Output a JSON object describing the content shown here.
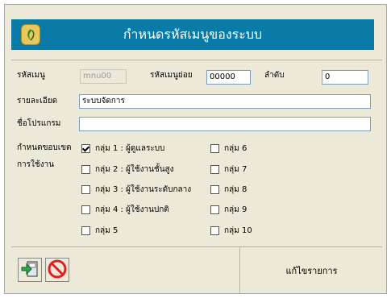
{
  "window": {
    "title": "กำหนดรหัสเมนูของระบบ"
  },
  "form": {
    "menu_code_label": "รหัสเมนู",
    "menu_code_value": "mnu00",
    "submenu_code_label": "รหัสเมนูย่อย",
    "submenu_code_value": "00000",
    "order_label": "ลำดับ",
    "order_value": "0",
    "detail_label": "รายละเอียด",
    "detail_value": "ระบบจัดการ",
    "program_name_label": "ชื่อโปรแกรม",
    "program_name_value": "",
    "scope_label_line1": "กำหนดขอบเขต",
    "scope_label_line2": "การใช้งาน"
  },
  "groups": [
    {
      "label": "กลุ่ม 1 : ผู้ดูแลระบบ",
      "checked": true
    },
    {
      "label": "กลุ่ม 2 : ผู้ใช้งานชั้นสูง",
      "checked": false
    },
    {
      "label": "กลุ่ม 3 : ผู้ใช้งานระดับกลาง",
      "checked": false
    },
    {
      "label": "กลุ่ม 4 : ผู้ใช้งานปกติ",
      "checked": false
    },
    {
      "label": "กลุ่ม 5",
      "checked": false
    },
    {
      "label": "กลุ่ม 6",
      "checked": false
    },
    {
      "label": "กลุ่ม 7",
      "checked": false
    },
    {
      "label": "กลุ่ม 8",
      "checked": false
    },
    {
      "label": "กลุ่ม 9",
      "checked": false
    },
    {
      "label": "กลุ่ม 10",
      "checked": false
    }
  ],
  "status": {
    "mode_text": "แก้ไขรายการ"
  },
  "colors": {
    "title_bar": "#0a7aa6",
    "window_bg": "#ece9d8",
    "cancel_red": "#e02020",
    "save_green": "#2fa84f"
  }
}
